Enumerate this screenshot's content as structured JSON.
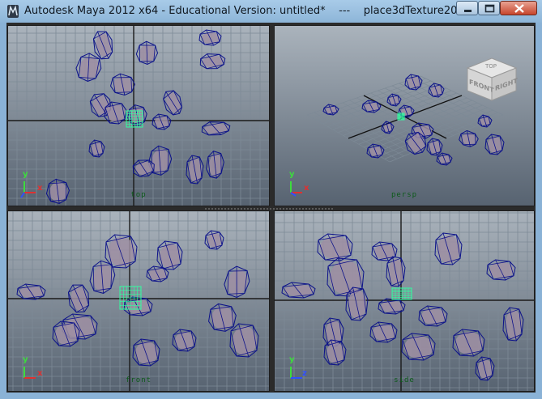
{
  "window": {
    "title": "Autodesk Maya 2012 x64 - Educational Version: untitled*    ---    place3dTexture20",
    "icon": "maya-app-icon",
    "controls": [
      "minimize-icon",
      "maximize-icon",
      "close-icon"
    ]
  },
  "viewports": {
    "top": {
      "label": "top",
      "axes": {
        "y": "y",
        "x": "x",
        "z": "z"
      }
    },
    "persp": {
      "label": "persp",
      "viewcube": {
        "front": "FRONT",
        "right": "RIGHT",
        "top": "TOP"
      },
      "axes": {
        "y": "y",
        "x": "x",
        "z": "z"
      }
    },
    "front": {
      "label": "front",
      "axes": {
        "y": "y",
        "x": "x"
      }
    },
    "side": {
      "label": "side",
      "axes": {
        "y": "y",
        "z": "z"
      }
    }
  },
  "colors": {
    "viewport_bg_top": "#aab3bc",
    "viewport_bg_bottom": "#566270",
    "grid": "#7d8a96",
    "wireframe": "#0d128a",
    "selected": "#30ffa0",
    "rock": "#9f8fa3"
  }
}
